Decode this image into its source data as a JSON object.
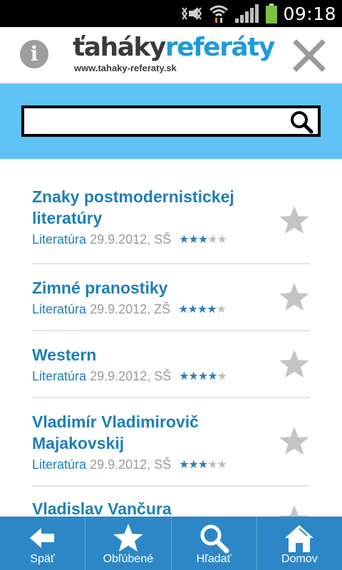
{
  "status_bar": {
    "time": "09:18",
    "icons": [
      "mute-icon",
      "wifi-icon",
      "signal-icon",
      "battery-icon"
    ],
    "battery_color": "#7bc043"
  },
  "header": {
    "logo_dark": "ťaháky",
    "logo_blue": "referáty",
    "logo_url": "www.tahaky-referaty.sk",
    "info_icon": "info-icon",
    "close_icon": "close-icon"
  },
  "search": {
    "value": "",
    "placeholder": "",
    "icon": "search-icon",
    "band_color": "#5fc3f5"
  },
  "items": [
    {
      "title": "Znaky postmodernistickej literatúry",
      "category": "Literatúra",
      "date": "29.9.2012,",
      "level": "SŠ",
      "rating": 3,
      "max_rating": 5
    },
    {
      "title": "Zimné pranostiky",
      "category": "Literatúra",
      "date": "29.9.2012,",
      "level": "ZŠ",
      "rating": 4,
      "max_rating": 5
    },
    {
      "title": "Western",
      "category": "Literatúra",
      "date": "29.9.2012,",
      "level": "SŠ",
      "rating": 4,
      "max_rating": 5
    },
    {
      "title": "Vladimír Vladimirovič Majakovskij",
      "category": "Literatúra",
      "date": "29.9.2012,",
      "level": "SŠ",
      "rating": 3,
      "max_rating": 5
    },
    {
      "title": "Vladislav Vančura",
      "category": "",
      "date": "",
      "level": "",
      "rating": 0,
      "max_rating": 5
    }
  ],
  "bottom_nav": [
    {
      "label": "Späť",
      "icon": "back-arrow-icon"
    },
    {
      "label": "Obľúbené",
      "icon": "star-icon"
    },
    {
      "label": "Hľadať",
      "icon": "search-icon"
    },
    {
      "label": "Domov",
      "icon": "home-icon"
    }
  ],
  "colors": {
    "accent": "#1e7fb8",
    "nav_background": "#2d87c6",
    "star_filled": "#2e7fb4",
    "star_empty": "#bdbdbd"
  }
}
